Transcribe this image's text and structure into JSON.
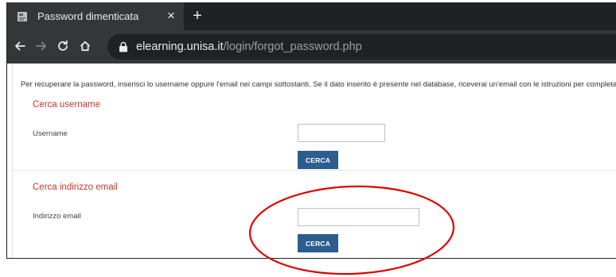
{
  "browser": {
    "tab": {
      "title": "Password dimenticata",
      "close_glyph": "×",
      "favicon": "document-icon"
    },
    "new_tab_glyph": "+",
    "nav": {
      "back": "arrow-left-icon",
      "forward": "arrow-right-icon",
      "reload": "reload-icon",
      "home": "home-icon"
    },
    "url": {
      "host": "elearning.unisa.it",
      "path": "/login/forgot_password.php"
    }
  },
  "page": {
    "intro": "Per recuperare la password, inserisci lo username oppure l'email nei campi sottostanti. Se il dato inserito è presente nel database, riceverai un'email con le istruzioni per completare il recupero",
    "username_section": {
      "title": "Cerca username",
      "label": "Username",
      "value": "",
      "button": "CERCA"
    },
    "email_section": {
      "title": "Cerca indirizzo email",
      "label": "Indirizzo email",
      "value": "",
      "button": "CERCA"
    }
  },
  "colors": {
    "tabstrip": "#202124",
    "toolbar": "#35363a",
    "section_title": "#c0392b",
    "button": "#2c5d8f",
    "annotation": "#e00000"
  }
}
